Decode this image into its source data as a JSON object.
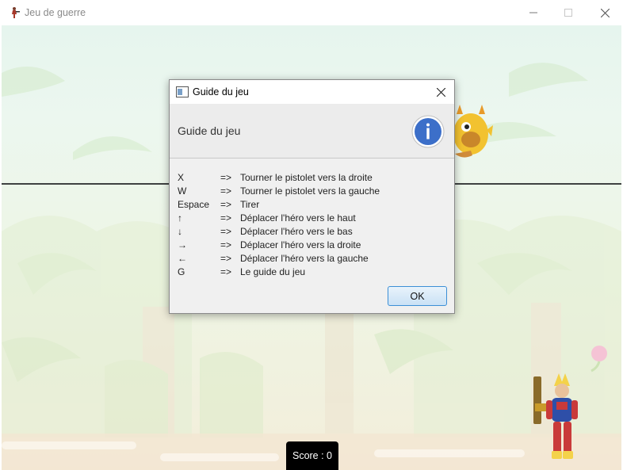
{
  "window": {
    "title": "Jeu de guerre",
    "icon": "soldier-icon",
    "controls": [
      "minimize-icon",
      "maximize-icon",
      "close-icon"
    ]
  },
  "dialog": {
    "title": "Guide du jeu",
    "header": "Guide du jeu",
    "header_icon": "info-icon",
    "items": [
      {
        "key": "X",
        "arrow": "=>",
        "action": "Tourner le pistolet vers la droite"
      },
      {
        "key": "W",
        "arrow": "=>",
        "action": "Tourner le pistolet vers la gauche"
      },
      {
        "key": "Espace",
        "arrow": "=>",
        "action": "Tirer"
      },
      {
        "key": "↑",
        "arrow": "=>",
        "action": "Déplacer l'héro vers le haut"
      },
      {
        "key": "↓",
        "arrow": "=>",
        "action": "Déplacer l'héro vers le bas"
      },
      {
        "key": "→",
        "arrow": "=>",
        "action": "Déplacer l'héro vers la droite"
      },
      {
        "key": "←",
        "arrow": "=>",
        "action": "Déplacer l'héro vers la gauche"
      },
      {
        "key": "G",
        "arrow": "=>",
        "action": "Le guide du jeu"
      }
    ],
    "ok_label": "OK"
  },
  "game": {
    "score_text": "Score : 0"
  },
  "colors": {
    "accent": "#3c78d8",
    "sky": "#e6f5ee",
    "ground": "#f5ead8"
  }
}
